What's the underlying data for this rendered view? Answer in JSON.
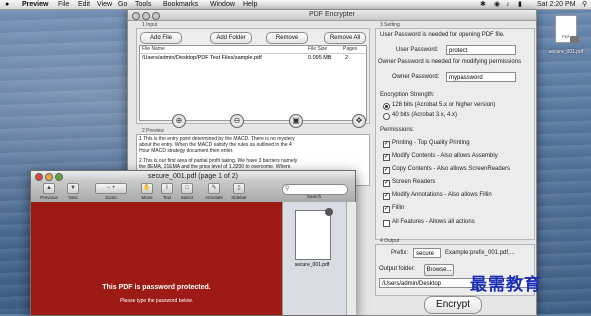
{
  "menubar": {
    "apple": "",
    "items": [
      "Preview",
      "File",
      "Edit",
      "View",
      "Go",
      "Tools",
      "Bookmarks",
      "Window",
      "Help"
    ],
    "clock": "Sat 2:20 PM"
  },
  "desktop_icon": {
    "doc_label": "PDF",
    "caption": "secure_001.pdf"
  },
  "encrypter": {
    "title": "PDF Encrypter",
    "input": {
      "section": "1 Input",
      "buttons": {
        "add_file": "Add File",
        "add_folder": "Add Folder",
        "remove": "Remove",
        "remove_all": "Remove All"
      },
      "columns": [
        "File Name",
        "File Size",
        "Pages"
      ],
      "rows": [
        {
          "name": "/Users/admin/Desktop/PDF Test Files/sample.pdf",
          "size": "0.095 MB",
          "pages": "2"
        }
      ]
    },
    "preview": {
      "section": "2 Preview",
      "lines": [
        "1   This is the entry point determined by the MACD. There is no mystery",
        "     about the entry. When the MACD satisfy the rules as outlined in the 4",
        "     Hour MACD strategy document then enter.",
        "",
        "2   This is our first area of partial profit taking. We have 3 barriers namely",
        "     the 8EMA, 21EMA and the price level of  1.3200 to overcome. Where"
      ]
    },
    "setting": {
      "section": "3 Setting",
      "user_pw_note": "User Password is needed for opening PDF file.",
      "user_pw_label": "User Password:",
      "user_pw_value": "protect",
      "owner_pw_note": "Owner Password is needed for modifying permissions",
      "owner_pw_label": "Owner Password:",
      "owner_pw_value": "mypassword",
      "strength_label": "Encryption Strength:",
      "strength_128": "128 bits (Acrobat 5.x or higher version)",
      "strength_40": "40 bits (Acrobat 3.x, 4.x)",
      "permissions_label": "Permissions:",
      "perm_printing": "Printing - Top Quality Printing",
      "perm_modify": "Modify Contents - Also allows Assembly",
      "perm_copy": "Copy Contents - Also allows ScreenReaders",
      "perm_screen": "Screen Readers",
      "perm_annot": "Modify Annotations - Also allows Fillin",
      "perm_fillin": "Fillin",
      "perm_all": "All Features - Allows all actions"
    },
    "output": {
      "section": "4 Output",
      "prefix_label": "Prefix:",
      "prefix_value": "secure",
      "prefix_example": "Example:prefix_001.pdf,...",
      "folder_label": "Output folder:",
      "browse": "Browse...",
      "folder_value": "/Users/admin/Desktop"
    },
    "encrypt": "Encrypt"
  },
  "preview_window": {
    "title": "secure_001.pdf (page 1 of 2)",
    "toolbar": [
      "Previous",
      "Next",
      "Zoom",
      "Move",
      "Text",
      "Select",
      "Annotate",
      "Sidebar"
    ],
    "search_label": "Search",
    "message": "This PDF is password protected.",
    "submessage": "Please type the password below.",
    "thumb_label": "secure_001.pdf"
  },
  "watermark": "最需教育"
}
